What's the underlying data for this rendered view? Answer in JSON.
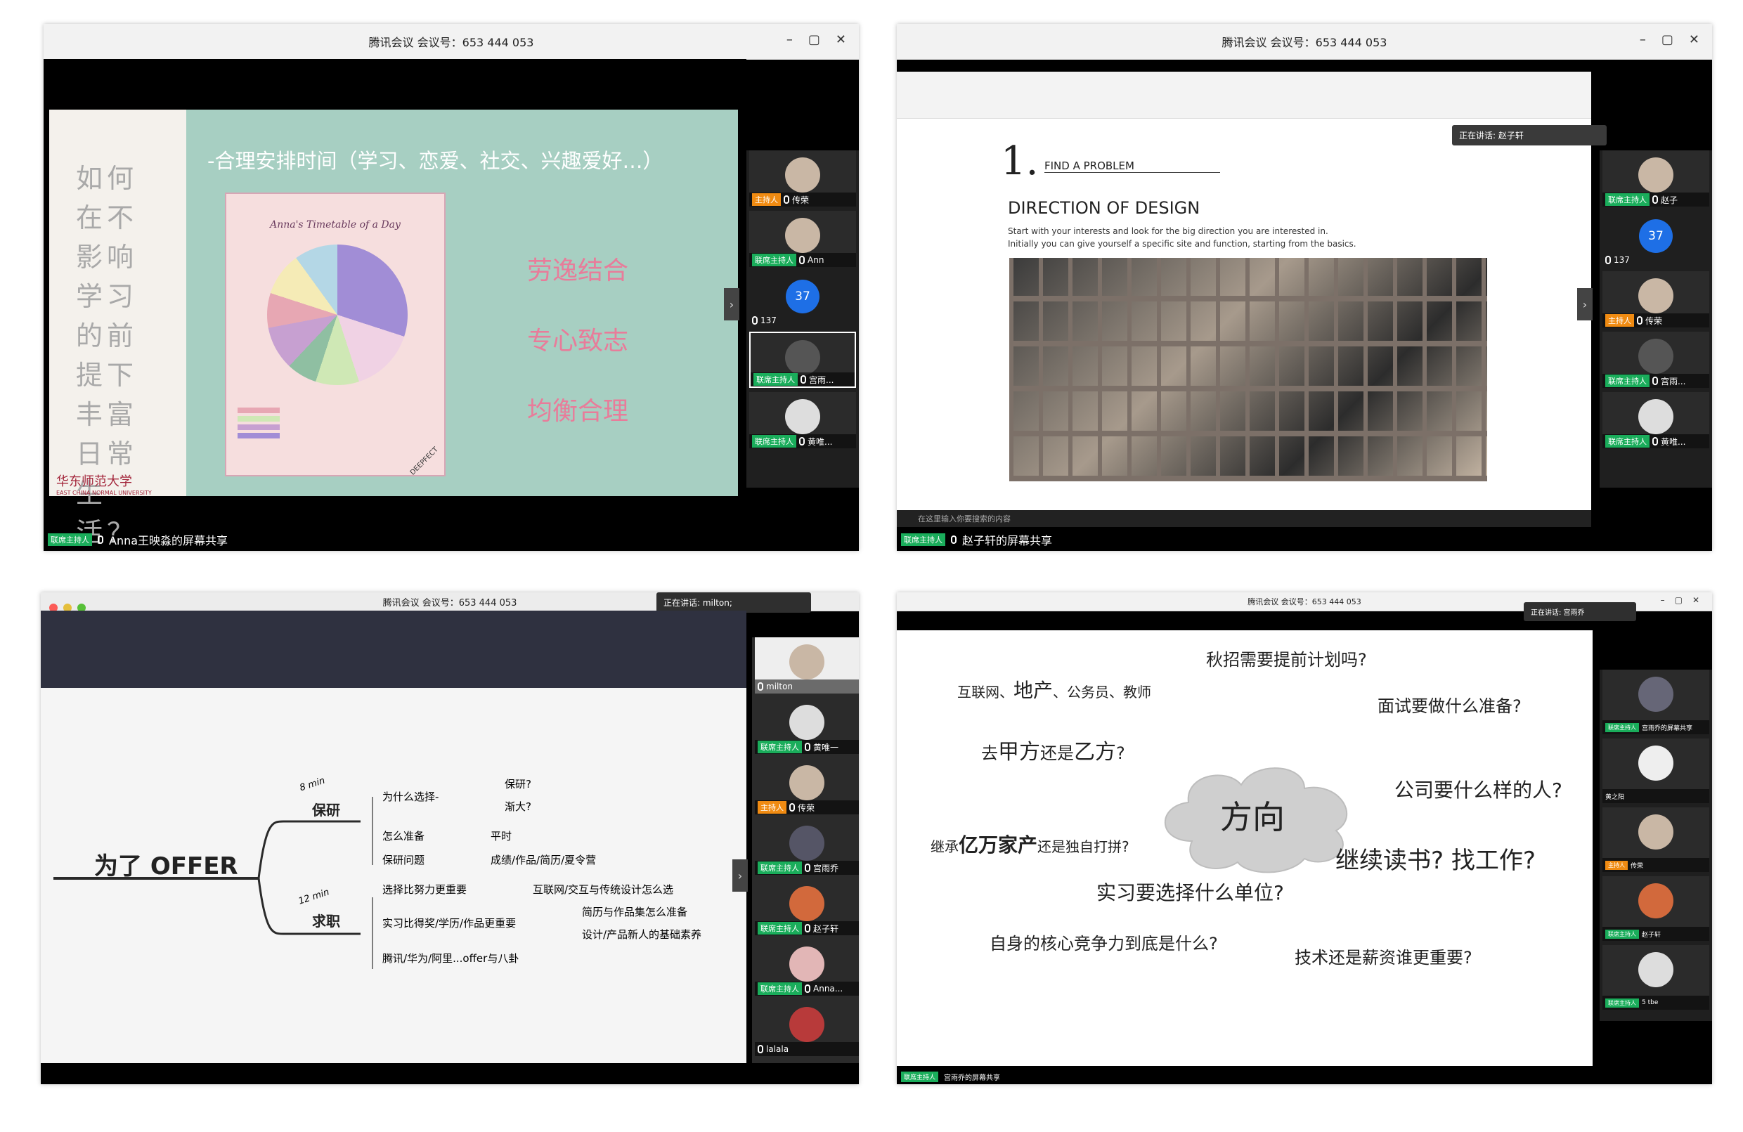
{
  "windows": [
    {
      "title": "腾讯会议 会议号：653 444 053",
      "vertical_text": "如何在不影响学习的前提下丰富日常生活？",
      "slide_heading": "-合理安排时间（学习、恋爱、社交、兴趣爱好…）",
      "timetable_title": "Anna's Timetable of a Day",
      "slogans": [
        "劳逸结合",
        "专心致志",
        "均衡合理"
      ],
      "university": "华东师范大学",
      "university_en": "EAST CHINA NORMAL UNIVERSITY",
      "corner_mark": "DEEPFECT",
      "participants": [
        {
          "role": "主持人",
          "name": "传荣"
        },
        {
          "role": "联席主持人",
          "name": "Ann"
        },
        {
          "role": "",
          "name": "137",
          "badge": "37"
        },
        {
          "role": "联席主持人",
          "name": "宫雨..."
        },
        {
          "role": "联席主持人",
          "name": "黄唯..."
        }
      ],
      "status_role": "联席主持人",
      "status_text": "Anna王映淼的屏幕共享"
    },
    {
      "title": "腾讯会议 会议号：653 444 053",
      "step_number": "1.",
      "step_label": "FIND A PROBLEM",
      "heading": "DIRECTION OF DESIGN",
      "body_line1": "Start with your interests and look for the big direction you are interested in.",
      "body_line2": "Initially you can give yourself a specific site and function, starting from the basics.",
      "speaking_now": "正在讲话: 赵子轩",
      "taskbar_search": "在这里输入你要搜索的内容",
      "participants": [
        {
          "role": "联席主持人",
          "name": "赵子"
        },
        {
          "role": "",
          "name": "137",
          "badge": "37"
        },
        {
          "role": "主持人",
          "name": "传荣"
        },
        {
          "role": "联席主持人",
          "name": "宫雨..."
        },
        {
          "role": "联席主持人",
          "name": "黄唯..."
        }
      ],
      "status_role": "联席主持人",
      "status_text": "赵子轩的屏幕共享"
    },
    {
      "title": "腾讯会议 会议号：653 444 053",
      "speaking_now": "正在讲话: milton;",
      "root": "为了 OFFER",
      "branch1": {
        "label": "保研",
        "note": "8 min"
      },
      "branch2": {
        "label": "求职",
        "note": "12 min"
      },
      "b1_items": [
        "为什么选择-",
        "保研?",
        "渐大?",
        "怎么准备",
        "平时",
        "保研问题",
        "成绩/作品/简历/夏令营"
      ],
      "b2_items": [
        "选择比努力更重要",
        "互联网/交互与传统设计怎么选",
        "简历与作品集怎么准备",
        "实习比得奖/学历/作品更重要",
        "设计/产品新人的基础素养",
        "腾讯/华为/阿里...offer与八卦"
      ],
      "participants": [
        {
          "role": "",
          "name": "milton"
        },
        {
          "role": "联席主持人",
          "name": "黄唯一"
        },
        {
          "role": "主持人",
          "name": "传荣"
        },
        {
          "role": "联席主持人",
          "name": "宫雨乔"
        },
        {
          "role": "联席主持人",
          "name": "赵子轩"
        },
        {
          "role": "联席主持人",
          "name": "Anna..."
        },
        {
          "role": "",
          "name": "lalala"
        }
      ]
    },
    {
      "title": "腾讯会议 会议号：653 444 053",
      "speaking_now": "正在讲话: 宫雨乔",
      "cloud_center": "方向",
      "q_autumn": "秋招需要提前计划吗?",
      "industries": [
        "互联网、",
        "地产",
        "、公务员、教师"
      ],
      "q_interview": "面试要做什么准备?",
      "q_party_a": "去",
      "q_party_b": "甲方",
      "q_party_c": "还是",
      "q_party_d": "乙方",
      "q_party_e": "?",
      "q_company": "公司要什么样的人?",
      "q_inherit_a": "继承",
      "q_inherit_b": "亿万家产",
      "q_inherit_c": "还是独自打拼?",
      "q_study": "继续读书? 找工作?",
      "q_intern": "实习要选择什么单位?",
      "q_core": "自身的核心竞争力到底是什么?",
      "q_tech": "技术还是薪资谁更重要?",
      "participants": [
        {
          "role": "联席主持人",
          "name": "宫雨乔的屏幕共享"
        },
        {
          "role": "",
          "name": "黄之阳"
        },
        {
          "role": "主持人",
          "name": "传荣"
        },
        {
          "role": "联席主持人",
          "name": "赵子轩"
        },
        {
          "role": "联席主持人",
          "name": "5 tbe"
        }
      ],
      "status_role": "联席主持人",
      "status_text": "宫雨乔的屏幕共享"
    }
  ],
  "colors": {
    "tencent_green": "#1aad5b",
    "host_orange": "#f08b12",
    "badge_blue": "#1e6fe6",
    "slide_mint": "#a7cfc2",
    "slogan_pink": "#e87c9a"
  }
}
